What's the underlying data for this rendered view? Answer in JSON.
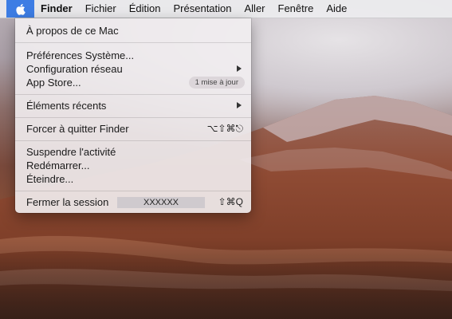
{
  "menubar": {
    "apple_icon": "apple-logo-icon",
    "items": [
      "Finder",
      "Fichier",
      "Édition",
      "Présentation",
      "Aller",
      "Fenêtre",
      "Aide"
    ]
  },
  "apple_menu": {
    "about": "À propos de ce Mac",
    "system_prefs": "Préférences Système...",
    "network": "Configuration réseau",
    "app_store": "App Store...",
    "app_store_badge": "1 mise à jour",
    "recent": "Éléments récents",
    "force_quit": "Forcer à quitter Finder",
    "force_quit_shortcut": "⌥⇧⌘⎋",
    "sleep": "Suspendre l'activité",
    "restart": "Redémarrer...",
    "shutdown": "Éteindre...",
    "logout": "Fermer la session",
    "logout_user": "XXXXXX",
    "logout_shortcut": "⇧⌘Q"
  },
  "colors": {
    "apple_highlight": "#3d7de4",
    "menu_bg": "#f2eef1"
  }
}
